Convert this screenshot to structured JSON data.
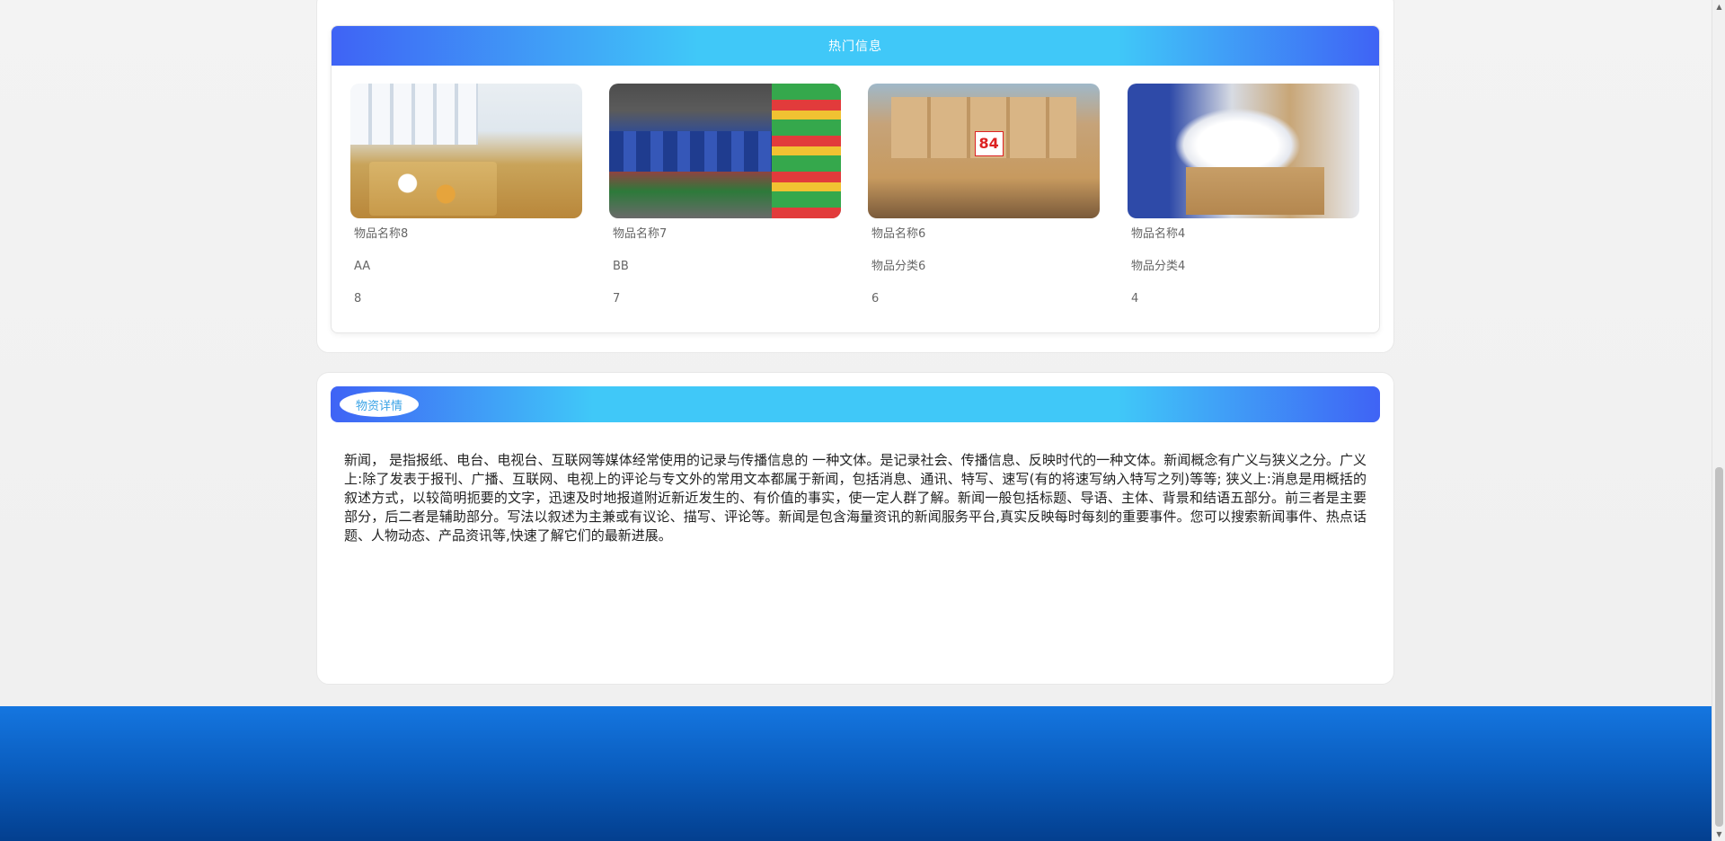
{
  "hot": {
    "title": "热门信息",
    "items": [
      {
        "name": "物品名称8",
        "category": "AA",
        "count": "8"
      },
      {
        "name": "物品名称7",
        "category": "BB",
        "count": "7"
      },
      {
        "name": "物品名称6",
        "category": "物品分类6",
        "count": "6"
      },
      {
        "name": "物品名称4",
        "category": "物品分类4",
        "count": "4"
      }
    ]
  },
  "detail": {
    "title": "物资详情",
    "text": "新闻， 是指报纸、电台、电视台、互联网等媒体经常使用的记录与传播信息的 一种文体。是记录社会、传播信息、反映时代的一种文体。新闻概念有广义与狭义之分。广义上:除了发表于报刊、广播、互联网、电视上的评论与专文外的常用文本都属于新闻，包括消息、通讯、特写、速写(有的将速写纳入特写之列)等等; 狭义上:消息是用概括的叙述方式，以较简明扼要的文字，迅速及时地报道附近新近发生的、有价值的事实，使一定人群了解。新闻一般包括标题、导语、主体、背景和结语五部分。前三者是主要部分，后二者是辅助部分。写法以叙述为主兼或有议论、描写、评论等。新闻是包含海量资讯的新闻服务平台,真实反映每时每刻的重要事件。您可以搜索新闻事件、热点话题、人物动态、产品资讯等,快速了解它们的最新进展。"
  },
  "scrollbar": {
    "up_icon": "▲",
    "down_icon": "▼"
  },
  "colors": {
    "header_blue": "#3f63f5",
    "header_cyan": "#40c8f8",
    "footer_blue": "#0a5ec0"
  }
}
